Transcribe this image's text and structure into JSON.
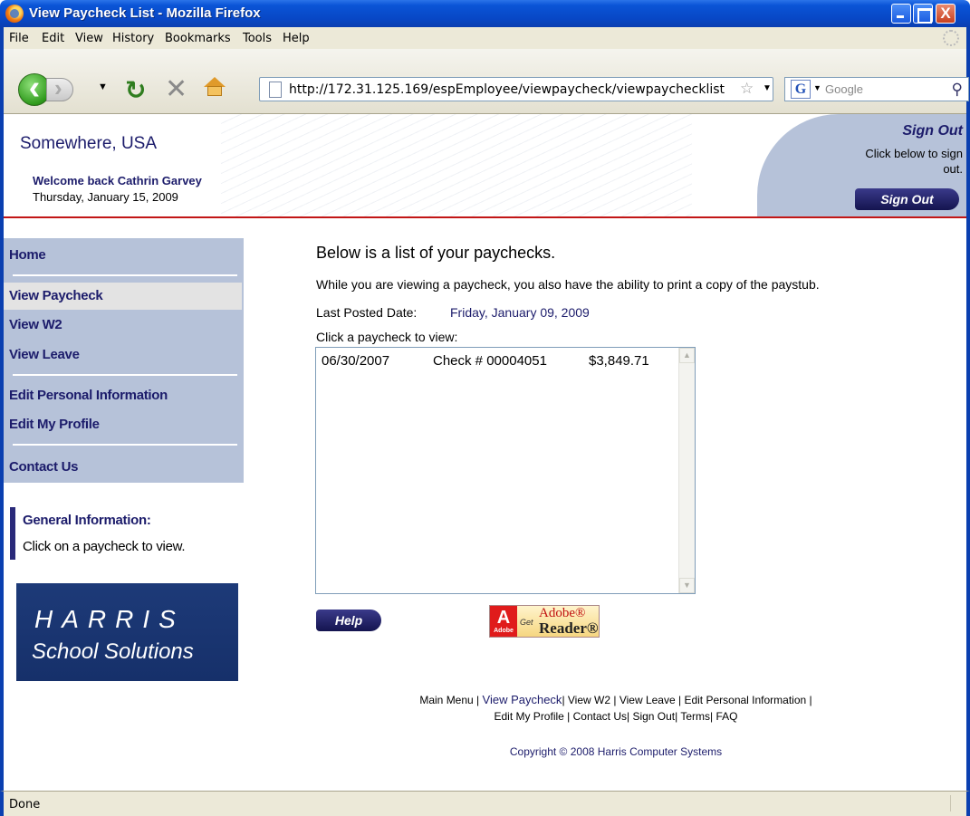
{
  "window": {
    "title": "View Paycheck List - Mozilla Firefox",
    "minimize": "_",
    "maximize": "□",
    "close": "X"
  },
  "menu": [
    "File",
    "Edit",
    "View",
    "History",
    "Bookmarks",
    "Tools",
    "Help"
  ],
  "navigation": {
    "url": "http://172.31.125.169/espEmployee/viewpaycheck/viewpaychecklist",
    "search_placeholder": "Google",
    "icons": [
      "back-icon",
      "forward-icon",
      "reload-icon",
      "stop-icon",
      "home-icon",
      "page-icon",
      "bookmark-star-icon",
      "google-icon",
      "search-icon"
    ]
  },
  "header": {
    "site_name": "Somewhere, USA",
    "welcome": "Welcome back Cathrin Garvey",
    "date": "Thursday, January 15, 2009",
    "signout_title": "Sign Out",
    "signout_desc": "Click below to sign out.",
    "signout_button": "Sign Out"
  },
  "sidebar": {
    "items": [
      "Home",
      "View Paycheck",
      "View W2",
      "View Leave",
      "Edit Personal Information",
      "Edit My Profile",
      "Contact Us"
    ],
    "active": "View Paycheck",
    "info_title": "General Information:",
    "info_text": "Click on a paycheck to view.",
    "logo_line1": "HARRIS",
    "logo_line2": "School Solutions"
  },
  "main": {
    "title": "Below is a list of your paychecks.",
    "description": "While you are viewing a paycheck, you also have the ability to print a copy of the paystub.",
    "last_posted_label": "Last Posted Date:",
    "last_posted_value": "Friday, January 09, 2009",
    "list_label": "Click a paycheck to view:",
    "paychecks": [
      {
        "date": "06/30/2007",
        "check": "Check # 00004051",
        "amount": "$3,849.71"
      }
    ],
    "help_button": "Help",
    "adobe_get": "Get",
    "adobe_name": "Adobe®",
    "adobe_reader": "Reader®",
    "adobe_logo_sub": "Adobe"
  },
  "footer": {
    "line1": [
      "Main Menu",
      "View Paycheck",
      "View W2",
      "View Leave",
      "Edit Personal Information"
    ],
    "line2": [
      "Edit My Profile",
      "Contact Us",
      "Sign Out",
      "Terms",
      "FAQ"
    ],
    "copyright": "Copyright © 2008 Harris Computer Systems"
  },
  "status": "Done",
  "colors": {
    "titlebar": "#0a54d6",
    "nav_panel": "#b6c2d9",
    "brand_navy": "#1c1c6b",
    "header_rule": "#c21616",
    "logo_bg": "#1d3a78"
  }
}
